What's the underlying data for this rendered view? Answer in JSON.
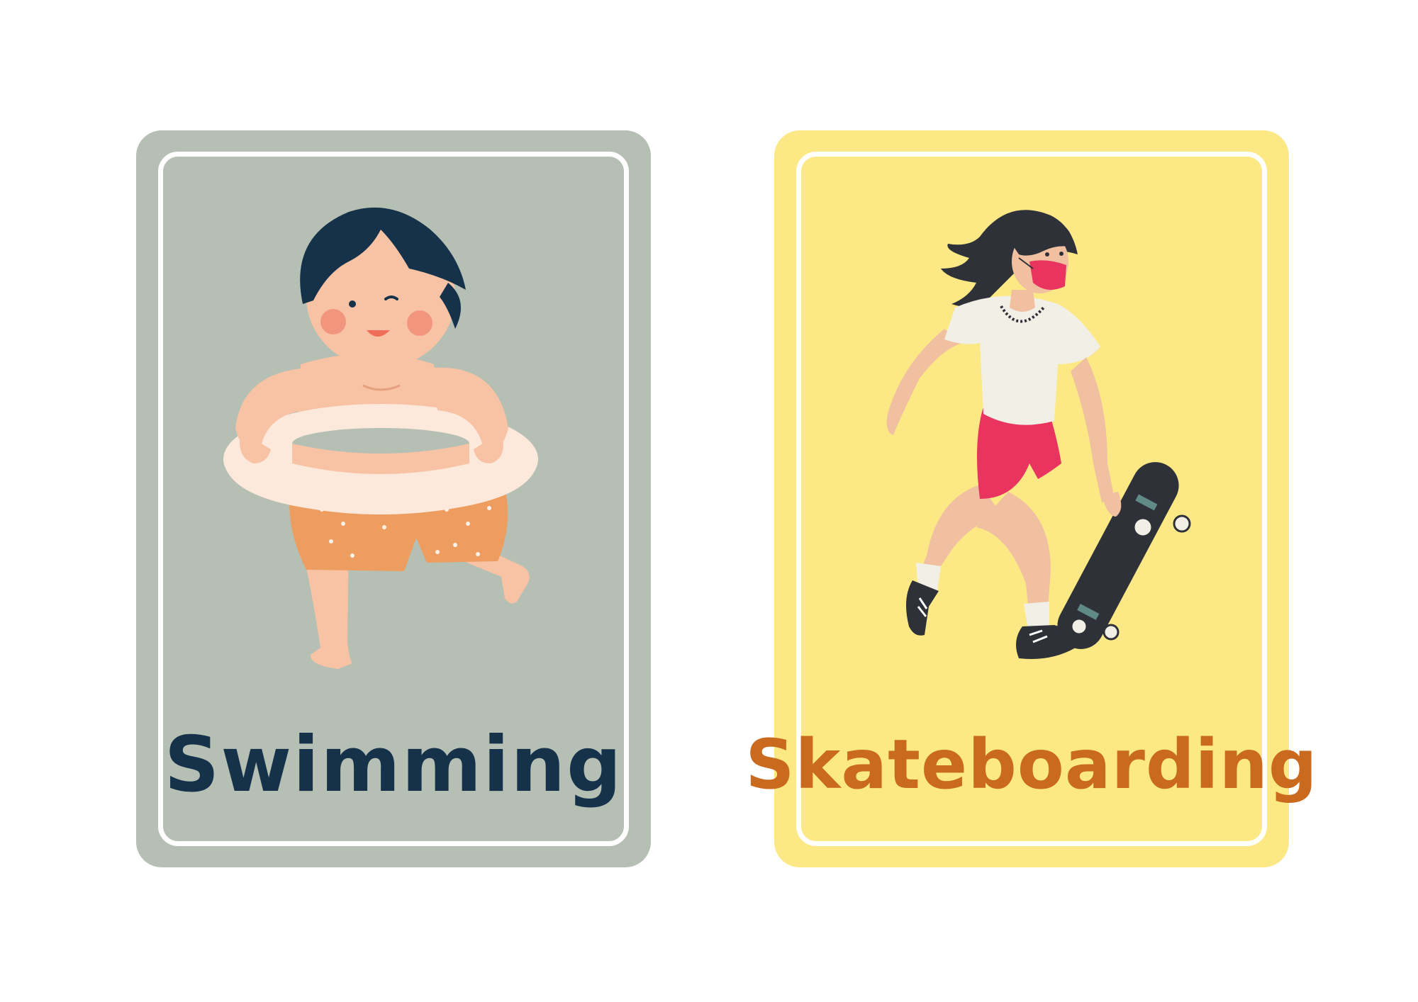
{
  "cards": [
    {
      "label": "Swimming",
      "illustration": "boy-with-swim-ring",
      "colors": {
        "card": "#b6bfb3",
        "text": "#15324a"
      }
    },
    {
      "label": "Skateboarding",
      "illustration": "girl-with-skateboard",
      "colors": {
        "card": "#fce986",
        "text": "#c96a1f"
      }
    }
  ]
}
